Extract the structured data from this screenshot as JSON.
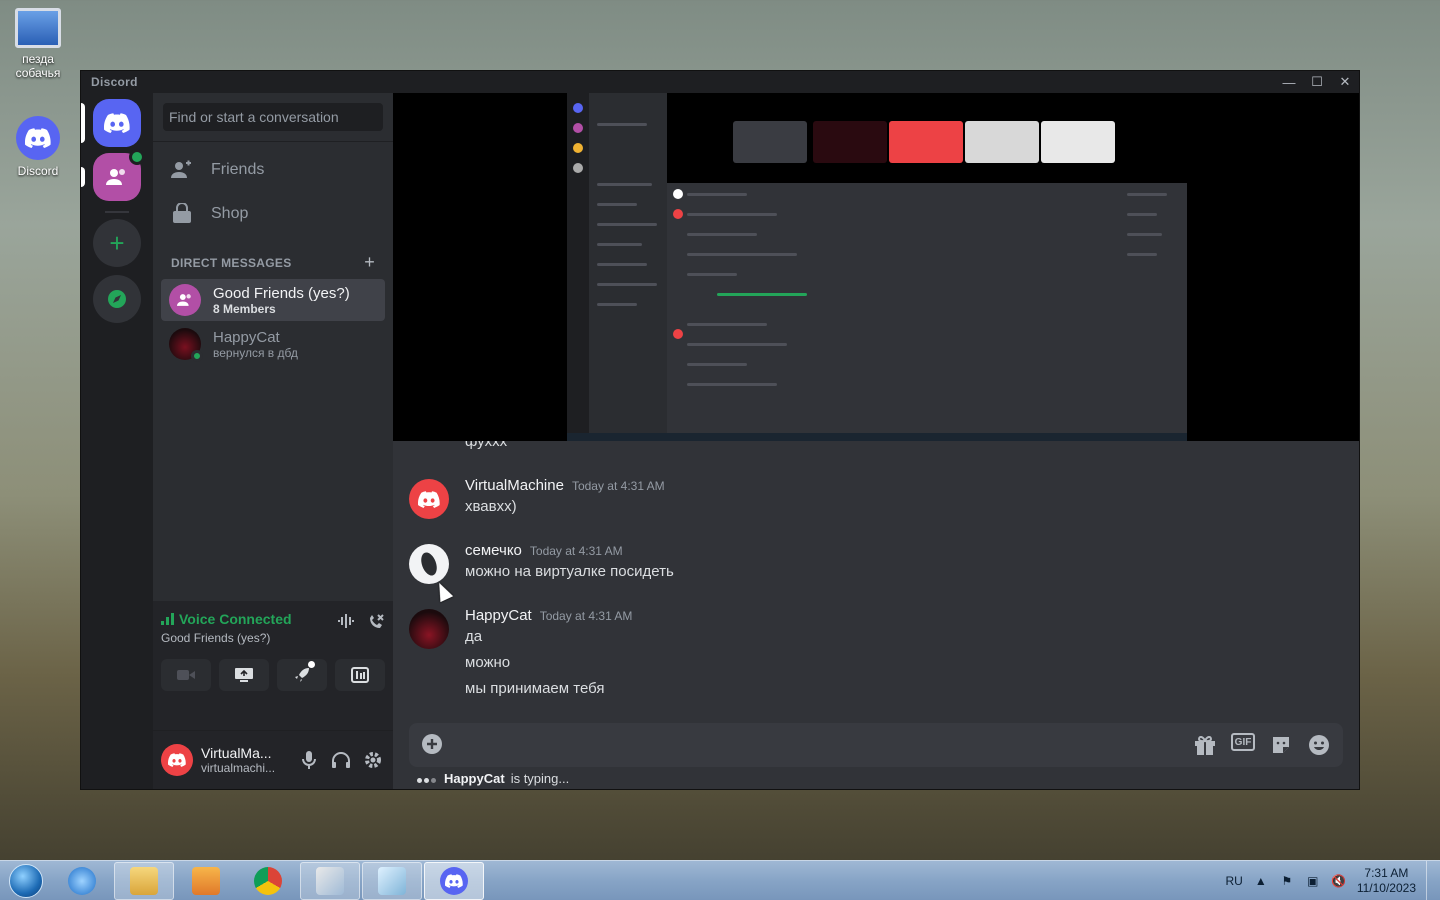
{
  "desktop": {
    "icons": [
      {
        "label": "пезда собачья",
        "icon": "monitor-icon"
      },
      {
        "label": "Discord",
        "icon": "discord-icon"
      }
    ]
  },
  "window": {
    "title": "Discord",
    "controls": {
      "minimize": "—",
      "maximize": "☐",
      "close": "✕"
    }
  },
  "sidebar": {
    "search_placeholder": "Find or start a conversation",
    "nav": [
      {
        "label": "Friends",
        "icon": "friends-icon"
      },
      {
        "label": "Shop",
        "icon": "shop-icon"
      }
    ],
    "dm_header": "DIRECT MESSAGES",
    "dms": [
      {
        "name": "Good Friends (yes?)",
        "sub": "8 Members",
        "selected": true
      },
      {
        "name": "HappyCat",
        "sub": "вернулся в дбд",
        "selected": false
      }
    ]
  },
  "voice": {
    "status": "Voice Connected",
    "channel": "Good Friends (yes?)"
  },
  "user": {
    "display_name": "VirtualMa...",
    "username": "virtualmachi..."
  },
  "chat": {
    "cutoff_text": "фухxx",
    "messages": [
      {
        "author": "VirtualMachine",
        "time": "Today at 4:31 AM",
        "lines": [
          "хвавхх)"
        ]
      },
      {
        "author": "семечко",
        "time": "Today at 4:31 AM",
        "lines": [
          "можно на виртуалке посидеть"
        ]
      },
      {
        "author": "HappyCat",
        "time": "Today at 4:31 AM",
        "lines": [
          "да",
          "можно",
          "мы принимаем тебя"
        ]
      }
    ],
    "composer_placeholder": "",
    "typing_user": "HappyCat",
    "typing_suffix": "is typing..."
  },
  "taskbar": {
    "lang": "RU",
    "time": "7:31 AM",
    "date": "11/10/2023"
  },
  "colors": {
    "blurple": "#5865f2",
    "green": "#23a559",
    "red": "#ed4245"
  }
}
